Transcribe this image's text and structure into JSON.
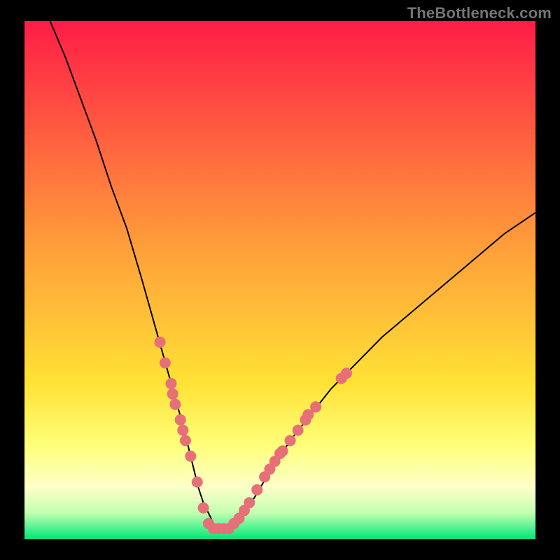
{
  "watermark": "TheBottleneck.com",
  "colors": {
    "gradient_top": "#ff1c47",
    "gradient_mid1": "#ff7a3a",
    "gradient_mid2": "#ffd936",
    "gradient_mid3": "#feffa4",
    "gradient_bottom": "#00e77a",
    "curve": "#000000",
    "marker": "#e76f78",
    "frame": "#000000"
  },
  "chart_data": {
    "type": "line",
    "title": "",
    "xlabel": "",
    "ylabel": "",
    "xlim": [
      0,
      100
    ],
    "ylim": [
      0,
      100
    ],
    "grid": false,
    "series": [
      {
        "name": "bottleneck-curve",
        "x": [
          5,
          8,
          11,
          14,
          17,
          20,
          23,
          25,
          27,
          29,
          31,
          32,
          33,
          34,
          35,
          36,
          37,
          38,
          39,
          40,
          42,
          45,
          48,
          52,
          56,
          60,
          65,
          70,
          76,
          82,
          88,
          94,
          100
        ],
        "y": [
          100,
          93,
          85,
          77,
          68,
          60,
          50,
          43,
          36,
          29,
          22,
          18,
          14,
          10,
          7,
          5,
          3,
          2,
          2,
          2,
          4,
          8,
          13,
          19,
          24,
          29,
          34,
          39,
          44,
          49,
          54,
          59,
          63
        ]
      }
    ],
    "markers": [
      {
        "x": 26.5,
        "y": 38
      },
      {
        "x": 27.5,
        "y": 34
      },
      {
        "x": 28.7,
        "y": 30
      },
      {
        "x": 29.0,
        "y": 28
      },
      {
        "x": 29.5,
        "y": 26
      },
      {
        "x": 30.5,
        "y": 23
      },
      {
        "x": 31.0,
        "y": 21
      },
      {
        "x": 31.5,
        "y": 19
      },
      {
        "x": 32.5,
        "y": 16
      },
      {
        "x": 33.8,
        "y": 11
      },
      {
        "x": 35.0,
        "y": 6
      },
      {
        "x": 36.0,
        "y": 3
      },
      {
        "x": 37.0,
        "y": 2
      },
      {
        "x": 38.0,
        "y": 2
      },
      {
        "x": 39.0,
        "y": 2
      },
      {
        "x": 40.0,
        "y": 2
      },
      {
        "x": 41.0,
        "y": 3
      },
      {
        "x": 42.0,
        "y": 4
      },
      {
        "x": 43.0,
        "y": 5.5
      },
      {
        "x": 44.0,
        "y": 7
      },
      {
        "x": 45.5,
        "y": 9.5
      },
      {
        "x": 47.0,
        "y": 12
      },
      {
        "x": 48.0,
        "y": 13.5
      },
      {
        "x": 49.0,
        "y": 15
      },
      {
        "x": 50.0,
        "y": 16.5
      },
      {
        "x": 50.5,
        "y": 17
      },
      {
        "x": 52.0,
        "y": 19
      },
      {
        "x": 53.5,
        "y": 21
      },
      {
        "x": 55.0,
        "y": 23
      },
      {
        "x": 55.5,
        "y": 24
      },
      {
        "x": 57.0,
        "y": 25.5
      },
      {
        "x": 62.0,
        "y": 31
      },
      {
        "x": 63.0,
        "y": 32
      }
    ]
  }
}
